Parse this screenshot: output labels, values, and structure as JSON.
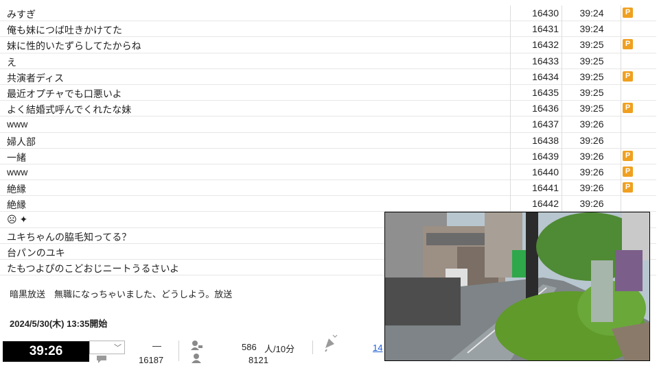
{
  "comments": [
    {
      "text": "みすぎ",
      "no": "16430",
      "time": "39:24",
      "premium": true
    },
    {
      "text": "俺も妹につば吐きかけてた",
      "no": "16431",
      "time": "39:24",
      "premium": false
    },
    {
      "text": "妹に性的いたずらしてたからね",
      "no": "16432",
      "time": "39:25",
      "premium": true
    },
    {
      "text": "え",
      "no": "16433",
      "time": "39:25",
      "premium": false
    },
    {
      "text": "共演者ディス",
      "no": "16434",
      "time": "39:25",
      "premium": true
    },
    {
      "text": "最近オプチャでも口悪いよ",
      "no": "16435",
      "time": "39:25",
      "premium": false
    },
    {
      "text": "よく結婚式呼んでくれたな妹",
      "no": "16436",
      "time": "39:25",
      "premium": true
    },
    {
      "text": "www",
      "no": "16437",
      "time": "39:26",
      "premium": false
    },
    {
      "text": "婦人部",
      "no": "16438",
      "time": "39:26",
      "premium": false
    },
    {
      "text": "一緒",
      "no": "16439",
      "time": "39:26",
      "premium": true
    },
    {
      "text": "www",
      "no": "16440",
      "time": "39:26",
      "premium": true
    },
    {
      "text": "絶縁",
      "no": "16441",
      "time": "39:26",
      "premium": true
    },
    {
      "text": "絶縁",
      "no": "16442",
      "time": "39:26",
      "premium": false
    },
    {
      "text": "☹ ✦",
      "no": "",
      "time": "",
      "premium": false
    },
    {
      "text": "ユキちゃんの脇毛知ってる？",
      "no": "",
      "time": "",
      "premium": false
    },
    {
      "text": "台パンのユキ",
      "no": "",
      "time": "",
      "premium": false
    },
    {
      "text": "たもつよぴのこどおじニートうるさいよ",
      "no": "",
      "time": "",
      "premium": false
    }
  ],
  "premium_badge": "P",
  "program": {
    "title": "暗黒放送　無職になっちゃいました、どうしよう。放送",
    "start": "2024/5/30(木) 13:35開始"
  },
  "status": {
    "elapsed": "39:26",
    "dash": "—",
    "comment_count": "16187",
    "viewers_per_10min": "586",
    "viewers_unit": "人/10分",
    "visitors": "8121",
    "partial_link": "14"
  },
  "colors": {
    "premium": "#f0a020",
    "link": "#1a5bd6",
    "timer_bg": "#000000"
  },
  "icons": [
    "dropdown-chevron-icon",
    "comment-icon",
    "viewer-icon",
    "visitor-icon",
    "ad-icon"
  ]
}
